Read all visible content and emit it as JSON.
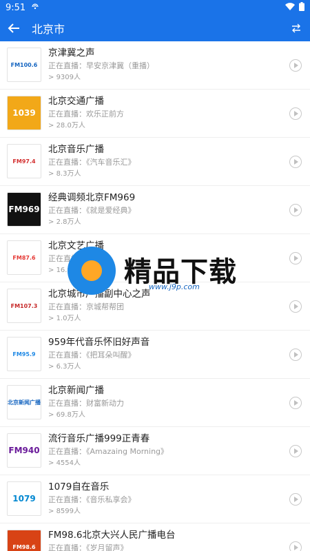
{
  "status": {
    "time": "9:51"
  },
  "toolbar": {
    "title": "北京市"
  },
  "stations": [
    {
      "name": "京津冀之声",
      "live": "正在直播：早安京津冀（重播）",
      "count": "9309人",
      "logo_text": "FM100.6",
      "logo_bg": "#ffffff",
      "logo_fg": "#1565c0"
    },
    {
      "name": "北京交通广播",
      "live": "正在直播：欢乐正前方",
      "count": "28.0万人",
      "logo_text": "1039",
      "logo_bg": "#f2a818",
      "logo_fg": "#ffffff"
    },
    {
      "name": "北京音乐广播",
      "live": "正在直播：《汽车音乐汇》",
      "count": "8.3万人",
      "logo_text": "FM97.4",
      "logo_bg": "#ffffff",
      "logo_fg": "#d32f2f"
    },
    {
      "name": "经典调频北京FM969",
      "live": "正在直播：《就是爱经典》",
      "count": "2.8万人",
      "logo_text": "FM969",
      "logo_bg": "#111111",
      "logo_fg": "#ffffff"
    },
    {
      "name": "北京文艺广播",
      "live": "正在直播：《文艺",
      "count": "16.9万人",
      "logo_text": "FM87.6",
      "logo_bg": "#ffffff",
      "logo_fg": "#e53935"
    },
    {
      "name": "北京城市广播副中心之声",
      "live": "正在直播：京城帮帮团",
      "count": "1.0万人",
      "logo_text": "FM107.3",
      "logo_bg": "#ffffff",
      "logo_fg": "#c62828"
    },
    {
      "name": "959年代音乐怀旧好声音",
      "live": "正在直播：《把耳朵叫醒》",
      "count": "6.3万人",
      "logo_text": "FM95.9",
      "logo_bg": "#ffffff",
      "logo_fg": "#1e88e5"
    },
    {
      "name": "北京新闻广播",
      "live": "正在直播：财富新动力",
      "count": "69.8万人",
      "logo_text": "北京新闻广播",
      "logo_bg": "#ffffff",
      "logo_fg": "#1565c0"
    },
    {
      "name": "流行音乐广播999正青春",
      "live": "正在直播：《Amazaing Morning》",
      "count": "4554人",
      "logo_text": "FM940",
      "logo_bg": "#ffffff",
      "logo_fg": "#6a1b9a"
    },
    {
      "name": "1079自在音乐",
      "live": "正在直播：《音乐私享会》",
      "count": "8599人",
      "logo_text": "1079",
      "logo_bg": "#ffffff",
      "logo_fg": "#0288d1"
    },
    {
      "name": "FM98.6北京大兴人民广播电台",
      "live": "正在直播：《岁月留声》",
      "count": "",
      "logo_text": "FM98.6",
      "logo_bg": "#d84315",
      "logo_fg": "#ffffff"
    }
  ],
  "watermark": {
    "brand": "精品下载",
    "url": "www.j9p.com"
  }
}
